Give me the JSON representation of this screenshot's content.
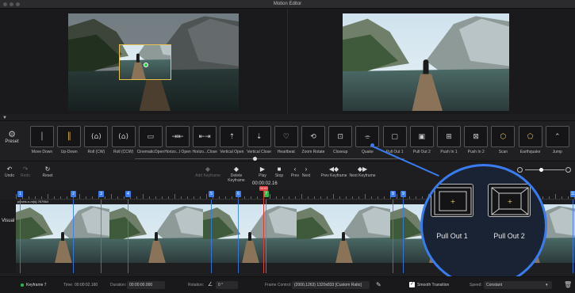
{
  "window": {
    "title": "Motion Editor"
  },
  "colors": {
    "accent": "#3a7cf0",
    "keyframe_active": "#2fb94b",
    "playhead": "#e23b3b",
    "crop": "#e8c44d"
  },
  "preset": {
    "label": "Preset",
    "icon": "sliders-icon"
  },
  "effects": [
    {
      "label": "Move Down",
      "icon": "move-down-icon"
    },
    {
      "label": "Up-Down",
      "icon": "up-down-icon"
    },
    {
      "label": "Roll (CW)",
      "icon": "roll-cw-icon"
    },
    {
      "label": "Roll (CCW)",
      "icon": "roll-ccw-icon"
    },
    {
      "label": "CinematicOpen",
      "icon": "cinematic-open-icon"
    },
    {
      "label": "Horizo...l Open",
      "icon": "horizontal-open-icon"
    },
    {
      "label": "Horizo...Close",
      "icon": "horizontal-close-icon"
    },
    {
      "label": "Vertical Open",
      "icon": "vertical-open-icon"
    },
    {
      "label": "Vertical Close",
      "icon": "vertical-close-icon"
    },
    {
      "label": "Heartbeat",
      "icon": "heartbeat-icon"
    },
    {
      "label": "Zoom Rotate",
      "icon": "zoom-rotate-icon"
    },
    {
      "label": "Closeup",
      "icon": "closeup-icon"
    },
    {
      "label": "Quake",
      "icon": "quake-icon"
    },
    {
      "label": "Pull Out 1",
      "icon": "pull-out-1-icon"
    },
    {
      "label": "Pull Out 2",
      "icon": "pull-out-2-icon"
    },
    {
      "label": "Push In 1",
      "icon": "push-in-1-icon"
    },
    {
      "label": "Push In 2",
      "icon": "push-in-2-icon"
    },
    {
      "label": "Scan",
      "icon": "scan-icon"
    },
    {
      "label": "Earthquake",
      "icon": "earthquake-icon"
    },
    {
      "label": "Jump",
      "icon": "jump-icon"
    }
  ],
  "toolbar": {
    "undo": "Undo",
    "redo": "Redo",
    "reset": "Reset",
    "add_keyframe": "Add Keyframe",
    "delete_keyframe": "Delete Keyframe",
    "play": "Play",
    "stop": "Stop",
    "prev": "Prev",
    "next": "Next",
    "prev_keyframe": "Prev Keyframe",
    "next_keyframe": "Next Keyframe",
    "timecode": "00:00:02.16"
  },
  "timeline": {
    "track_label": "Visual",
    "track_name": "pexels-n-m[n]-767964",
    "keyframes": [
      "1",
      "2",
      "3",
      "4",
      "5",
      "6",
      "7",
      "8",
      "9",
      "10",
      "11"
    ],
    "active_keyframe": "7",
    "playhead_label": "00:00"
  },
  "callout": {
    "left_label": "Pull Out 1",
    "right_label": "Pull Out 2"
  },
  "status": {
    "keyframe": "Keyframe 7",
    "time_label": "Time:",
    "time_value": "00:00:02.160",
    "duration_label": "Duration:",
    "duration_value": "00:00:00.000",
    "rotation_label": "Rotation:",
    "rotation_value": "0",
    "frame_label": "Frame Control:",
    "frame_value": "(2000,1263) 1320x833 [Custom Ratio]",
    "smooth_label": "Smooth Transition",
    "speed_label": "Speed:",
    "speed_value": "Constant"
  }
}
